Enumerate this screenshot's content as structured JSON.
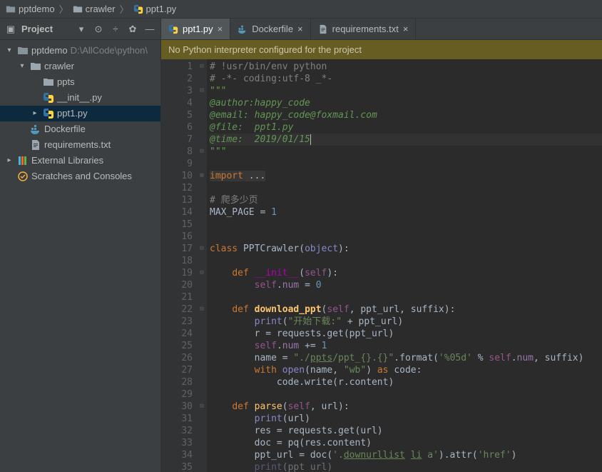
{
  "breadcrumbs": [
    {
      "label": "pptdemo",
      "icon": "folder-dark"
    },
    {
      "label": "crawler",
      "icon": "folder"
    },
    {
      "label": "ppt1.py",
      "icon": "py"
    }
  ],
  "sidebar": {
    "title": "Project",
    "tools": [
      "▾",
      "⊙",
      "÷",
      "✿",
      "—"
    ],
    "tree": [
      {
        "d": 0,
        "arrow": "▾",
        "icon": "folder-dark",
        "label": "pptdemo",
        "suffix": " D:\\AllCode\\python\\"
      },
      {
        "d": 1,
        "arrow": "▾",
        "icon": "folder",
        "label": "crawler"
      },
      {
        "d": 2,
        "arrow": "",
        "icon": "folder",
        "label": "ppts"
      },
      {
        "d": 2,
        "arrow": "",
        "icon": "py",
        "label": "__init__.py"
      },
      {
        "d": 2,
        "arrow": "▸",
        "icon": "py",
        "label": "ppt1.py",
        "sel": true
      },
      {
        "d": 1,
        "arrow": "",
        "icon": "docker",
        "label": "Dockerfile"
      },
      {
        "d": 1,
        "arrow": "",
        "icon": "txt",
        "label": "requirements.txt"
      },
      {
        "d": 0,
        "arrow": "▸",
        "icon": "lib",
        "label": "External Libraries"
      },
      {
        "d": 0,
        "arrow": "",
        "icon": "scratch",
        "label": "Scratches and Consoles"
      }
    ]
  },
  "tabs": [
    {
      "label": "ppt1.py",
      "icon": "py",
      "active": true
    },
    {
      "label": "Dockerfile",
      "icon": "docker"
    },
    {
      "label": "requirements.txt",
      "icon": "txt"
    }
  ],
  "banner": "No Python interpreter configured for the project",
  "code": {
    "lines": [
      {
        "n": 1,
        "fold": "-",
        "html": "<span class='cm'># !usr/bin/env python</span>"
      },
      {
        "n": 2,
        "html": "<span class='cm'># -*- coding:utf-8 _*-</span>"
      },
      {
        "n": 3,
        "fold": "-",
        "html": "<span class='ds'>\"\"\"</span>"
      },
      {
        "n": 4,
        "html": "<span class='ds'>@author:happy_code</span>"
      },
      {
        "n": 5,
        "html": "<span class='ds'>@email: happy_code@foxmail.com</span>"
      },
      {
        "n": 6,
        "html": "<span class='ds'>@file:  ppt1.py</span>"
      },
      {
        "n": 7,
        "caret": true,
        "html": "<span class='ds'>@time:  2019/01/15</span>"
      },
      {
        "n": 8,
        "fold": "-",
        "html": "<span class='ds'>\"\"\"</span>"
      },
      {
        "n": 9,
        "html": ""
      },
      {
        "n": 10,
        "fold": "+",
        "html": "<span style='background:#373737'><span class='kw'>import</span> ...</span>"
      },
      {
        "n": 12,
        "html": ""
      },
      {
        "n": 13,
        "html": "<span class='cm'># 爬多少页</span>"
      },
      {
        "n": 14,
        "html": "MAX_PAGE = <span class='nm'>1</span>"
      },
      {
        "n": 15,
        "html": ""
      },
      {
        "n": 16,
        "html": ""
      },
      {
        "n": 17,
        "fold": "-",
        "html": "<span class='kw'>class</span> PPTCrawler(<span class='bi'>object</span>):"
      },
      {
        "n": 18,
        "html": ""
      },
      {
        "n": 19,
        "fold": "-",
        "html": "    <span class='kw'>def</span> <span class='mg'>__init__</span>(<span class='sf'>self</span>):"
      },
      {
        "n": 20,
        "html": "        <span class='sf'>self</span>.<span class='pr'>num</span> = <span class='nm'>0</span>"
      },
      {
        "n": 21,
        "html": ""
      },
      {
        "n": 22,
        "fold": "-",
        "html": "    <span class='kw'>def</span> <span class='fn2'>download_ppt</span>(<span class='sf'>self</span>, ppt_url, suffix):"
      },
      {
        "n": 23,
        "html": "        <span class='bi'>print</span>(<span class='st'>\"开始下载:\"</span> + ppt_url)"
      },
      {
        "n": 24,
        "html": "        r = requests.get(ppt_url)"
      },
      {
        "n": 25,
        "html": "        <span class='sf'>self</span>.<span class='pr'>num</span> += <span class='nm'>1</span>"
      },
      {
        "n": 26,
        "html": "        name = <span class='st'>\"./<u>ppts</u>/ppt_{}.{}\"</span>.format(<span class='st'>'%05d'</span> % <span class='sf'>self</span>.<span class='pr'>num</span>, suffix)"
      },
      {
        "n": 27,
        "html": "        <span class='kw'>with</span> <span class='bi'>open</span>(name, <span class='st'>\"wb\"</span>) <span class='kw'>as</span> code:"
      },
      {
        "n": 28,
        "html": "            code.write(r.content)"
      },
      {
        "n": 29,
        "html": ""
      },
      {
        "n": 30,
        "fold": "-",
        "html": "    <span class='kw'>def</span> <span class='fn'>parse</span>(<span class='sf'>self</span>, url):"
      },
      {
        "n": 31,
        "html": "        <span class='bi'>print</span>(url)"
      },
      {
        "n": 32,
        "html": "        res = requests.get(url)"
      },
      {
        "n": 33,
        "html": "        doc = pq(res.content)"
      },
      {
        "n": 34,
        "html": "        ppt_url = doc(<span class='st'>'.<u>downurllist</u> <u>li</u> a'</span>).attr(<span class='st'>'href'</span>)"
      },
      {
        "n": 35,
        "html": "        <span class='bi' style='opacity:.5'>print</span><span style='opacity:.5'>(ppt url)</span>"
      }
    ]
  }
}
